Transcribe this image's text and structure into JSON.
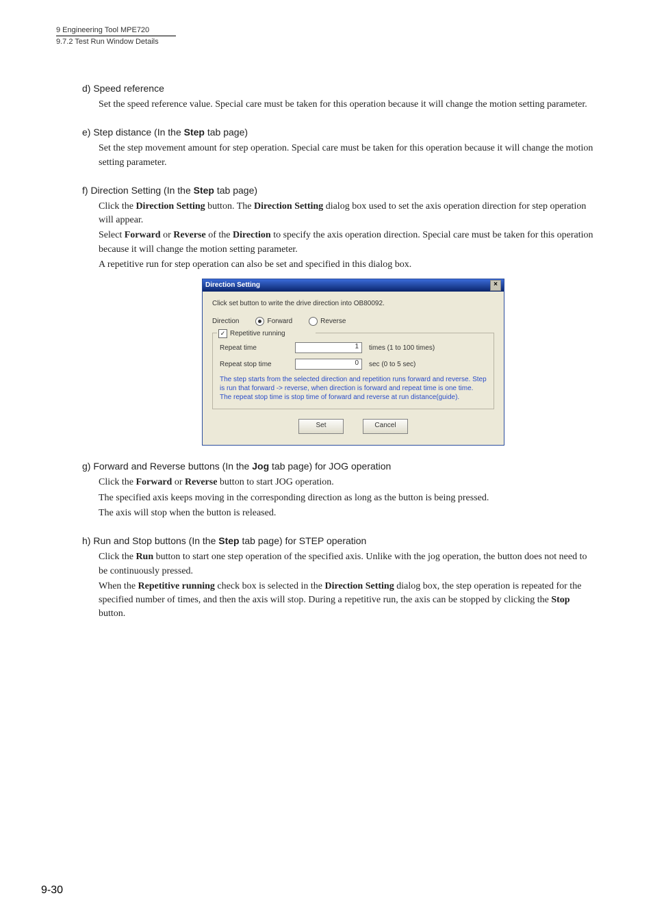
{
  "header": {
    "chapter": "9  Engineering Tool MPE720",
    "section": "9.7.2  Test Run Window Details"
  },
  "d": {
    "title": "d) Speed reference",
    "p1": "Set the speed reference value. Special care must be taken for this operation because it will change the motion setting parameter."
  },
  "e": {
    "title_before": "e) Step distance (In the ",
    "title_bold": "Step",
    "title_after": " tab page)",
    "p1": "Set the step movement amount for step operation. Special care must be taken for this operation because it will change the motion setting parameter."
  },
  "f": {
    "title_before": "f) Direction Setting (In the ",
    "title_bold": "Step",
    "title_after": " tab page)",
    "p1a": "Click the ",
    "p1b": "Direction Setting",
    "p1c": " button. The ",
    "p1d": "Direction Setting",
    "p1e": " dialog box used to set the axis operation direction for step operation will appear.",
    "p2a": "Select ",
    "p2b": "Forward",
    "p2c": " or ",
    "p2d": "Reverse",
    "p2e": " of the ",
    "p2f": "Direction",
    "p2g": " to specify the axis operation direction. Special care must be taken for this operation because it will change the motion setting parameter.",
    "p3": "A repetitive run for step operation can also be set and specified in this dialog box."
  },
  "dialog": {
    "title": "Direction Setting",
    "close": "×",
    "instruction": "Click set button to write the drive direction into OB80092.",
    "direction_label": "Direction",
    "forward": "Forward",
    "reverse": "Reverse",
    "repetitive": "Repetitive running",
    "repeat_time_label": "Repeat time",
    "repeat_time_value": "1",
    "repeat_time_unit": "times (1 to 100 times)",
    "repeat_stop_label": "Repeat stop time",
    "repeat_stop_value": "0",
    "repeat_stop_unit": "sec (0 to 5 sec)",
    "note": "The step starts from the selected direction and repetition runs forward and reverse. Step is run that forward -> reverse, when direction is forward and repeat time is one time. The repeat stop time is stop time of forward and reverse at run distance(guide).",
    "set": "Set",
    "cancel": "Cancel"
  },
  "g": {
    "title_before": "g) Forward and Reverse buttons (In the ",
    "title_bold": "Jog",
    "title_after": " tab page) for JOG operation",
    "p1a": "Click the ",
    "p1b": "Forward",
    "p1c": " or ",
    "p1d": "Reverse",
    "p1e": " button to start JOG operation.",
    "p2": "The specified axis keeps moving in the corresponding direction as long as the button is being pressed.",
    "p3": "The axis will stop when the button is released."
  },
  "h": {
    "title_before": "h) Run and Stop buttons (In the ",
    "title_bold": "Step",
    "title_after": " tab page) for STEP operation",
    "p1a": "Click the ",
    "p1b": "Run",
    "p1c": " button to start one step operation of the specified axis. Unlike with the jog operation, the button does not need to be continuously pressed.",
    "p2a": "When the ",
    "p2b": "Repetitive running",
    "p2c": " check box is selected in the ",
    "p2d": "Direction Setting",
    "p2e": " dialog box, the step operation is repeated for the specified number of times, and then the axis will stop. During a repetitive run, the axis can be stopped by clicking the ",
    "p2f": "Stop",
    "p2g": " button."
  },
  "page_number": "9-30"
}
